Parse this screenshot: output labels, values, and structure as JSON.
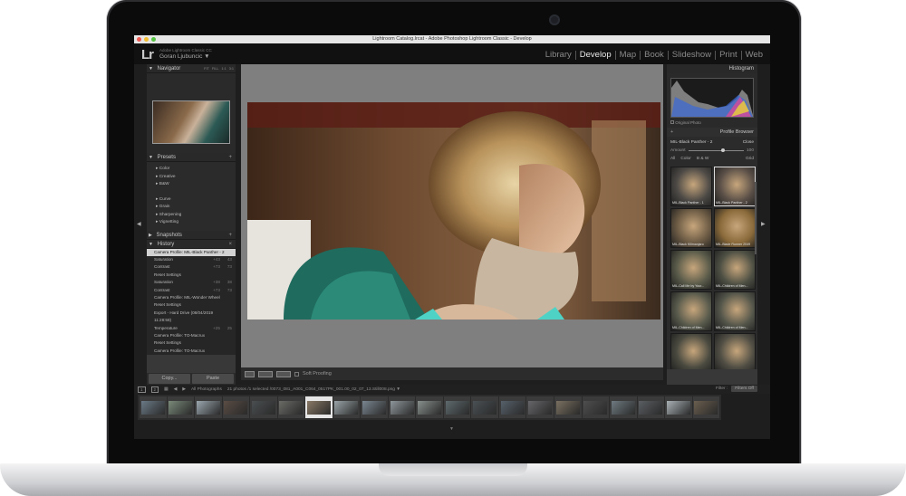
{
  "window": {
    "title": "Lightroom Catalog.lrcat - Adobe Photoshop Lightroom Classic - Develop"
  },
  "identity": {
    "logo": "Lr",
    "app_name": "Adobe Lightroom Classic CC",
    "user": "Goran Ljubuncic ▼"
  },
  "modules": [
    "Library",
    "Develop",
    "Map",
    "Book",
    "Slideshow",
    "Print",
    "Web"
  ],
  "active_module": "Develop",
  "navigator": {
    "title": "Navigator",
    "options": [
      "FIT",
      "FILL",
      "1:1",
      "3:1"
    ]
  },
  "presets": {
    "title": "Presets",
    "group_a": [
      "Color",
      "Creative",
      "B&W"
    ],
    "group_b": [
      "Curve",
      "Grain",
      "Sharpening",
      "Vignetting"
    ]
  },
  "snapshots": {
    "title": "Snapshots"
  },
  "history": {
    "title": "History",
    "items": [
      {
        "label": "Camera Profile: MIL-Black Panther - 2",
        "a": "",
        "b": "",
        "selected": true
      },
      {
        "label": "Saturation",
        "a": "+43",
        "b": "43"
      },
      {
        "label": "Contrast",
        "a": "+73",
        "b": "73"
      },
      {
        "label": "Reset Settings",
        "a": "",
        "b": ""
      },
      {
        "label": "Saturation",
        "a": "+38",
        "b": "38"
      },
      {
        "label": "Contrast",
        "a": "+73",
        "b": "73"
      },
      {
        "label": "Camera Profile: MIL-Wonder Wheel",
        "a": "",
        "b": ""
      },
      {
        "label": "Reset Settings",
        "a": "",
        "b": ""
      },
      {
        "label": "Export - Hard Drive (08/04/2019 11:28:58)",
        "a": "",
        "b": ""
      },
      {
        "label": "Temperature",
        "a": "+25",
        "b": "25"
      },
      {
        "label": "Camera Profile: TO-Macrux",
        "a": "",
        "b": ""
      },
      {
        "label": "Reset Settings",
        "a": "",
        "b": ""
      },
      {
        "label": "Camera Profile: TO-Macrux",
        "a": "",
        "b": ""
      }
    ]
  },
  "buttons": {
    "copy": "Copy...",
    "paste": "Paste"
  },
  "toolbar": {
    "soft_proofing": "Soft Proofing"
  },
  "histogram": {
    "title": "Histogram",
    "original_photo": "Original Photo"
  },
  "profile_browser": {
    "title": "Profile Browser",
    "current": "MIL-Black Panther - 2",
    "close": "Close",
    "amount_label": "Amount",
    "amount_value": "100",
    "tabs": [
      "All",
      "Color",
      "B & W"
    ],
    "grid_label": "Grid",
    "tiles": [
      {
        "label": "MIL-Black Panther - 1",
        "selected": false,
        "color": "#4d4a46"
      },
      {
        "label": "MIL-Black Panther - 2",
        "selected": true,
        "color": "#5b5048"
      },
      {
        "label": "MIL-Black Kilimanjaro",
        "selected": false,
        "color": "#6b5a44"
      },
      {
        "label": "MIL-Blade Runner 2049",
        "selected": false,
        "color": "#8a6a3a"
      },
      {
        "label": "MIL-Call Me by Your...",
        "selected": false,
        "color": "#5a5b4a"
      },
      {
        "label": "MIL-Children of Men...",
        "selected": false,
        "color": "#4e5044"
      },
      {
        "label": "MIL-Children of Men...",
        "selected": false,
        "color": "#585a4c"
      },
      {
        "label": "MIL-Children of Men...",
        "selected": false,
        "color": "#53554a"
      },
      {
        "label": "",
        "selected": false,
        "color": "#4a4a40"
      },
      {
        "label": "",
        "selected": false,
        "color": "#504e44"
      }
    ]
  },
  "filmstrip": {
    "views": [
      "1",
      "2"
    ],
    "source": "All Photographs",
    "info": "21 photos /1 selected /0073_081_A001_C064_0517PK_001.00_02_07_13.Still008.png ▼",
    "filter_label": "Filter :",
    "filter_value": "Filters Off",
    "thumbs": [
      {
        "color": "#6a7a86"
      },
      {
        "color": "#7a8a7a"
      },
      {
        "color": "#9aa6ae"
      },
      {
        "color": "#5a4c44"
      },
      {
        "color": "#4a4e50"
      },
      {
        "color": "#6a6a66"
      },
      {
        "color": "#8a7a66",
        "selected": true
      },
      {
        "color": "#9aa4a8"
      },
      {
        "color": "#7a8690"
      },
      {
        "color": "#8e969a"
      },
      {
        "color": "#88908c"
      },
      {
        "color": "#5e6a6e"
      },
      {
        "color": "#4a5054"
      },
      {
        "color": "#56606a"
      },
      {
        "color": "#66666a"
      },
      {
        "color": "#7a7060"
      },
      {
        "color": "#4e4e4e"
      },
      {
        "color": "#6e7a80"
      },
      {
        "color": "#5a5e62"
      },
      {
        "color": "#a8b0b4"
      },
      {
        "color": "#6a5e4e"
      }
    ]
  },
  "colors": {
    "accent": "#e9e9e9",
    "panel": "#383838",
    "canvas": "#7f7f7f"
  }
}
